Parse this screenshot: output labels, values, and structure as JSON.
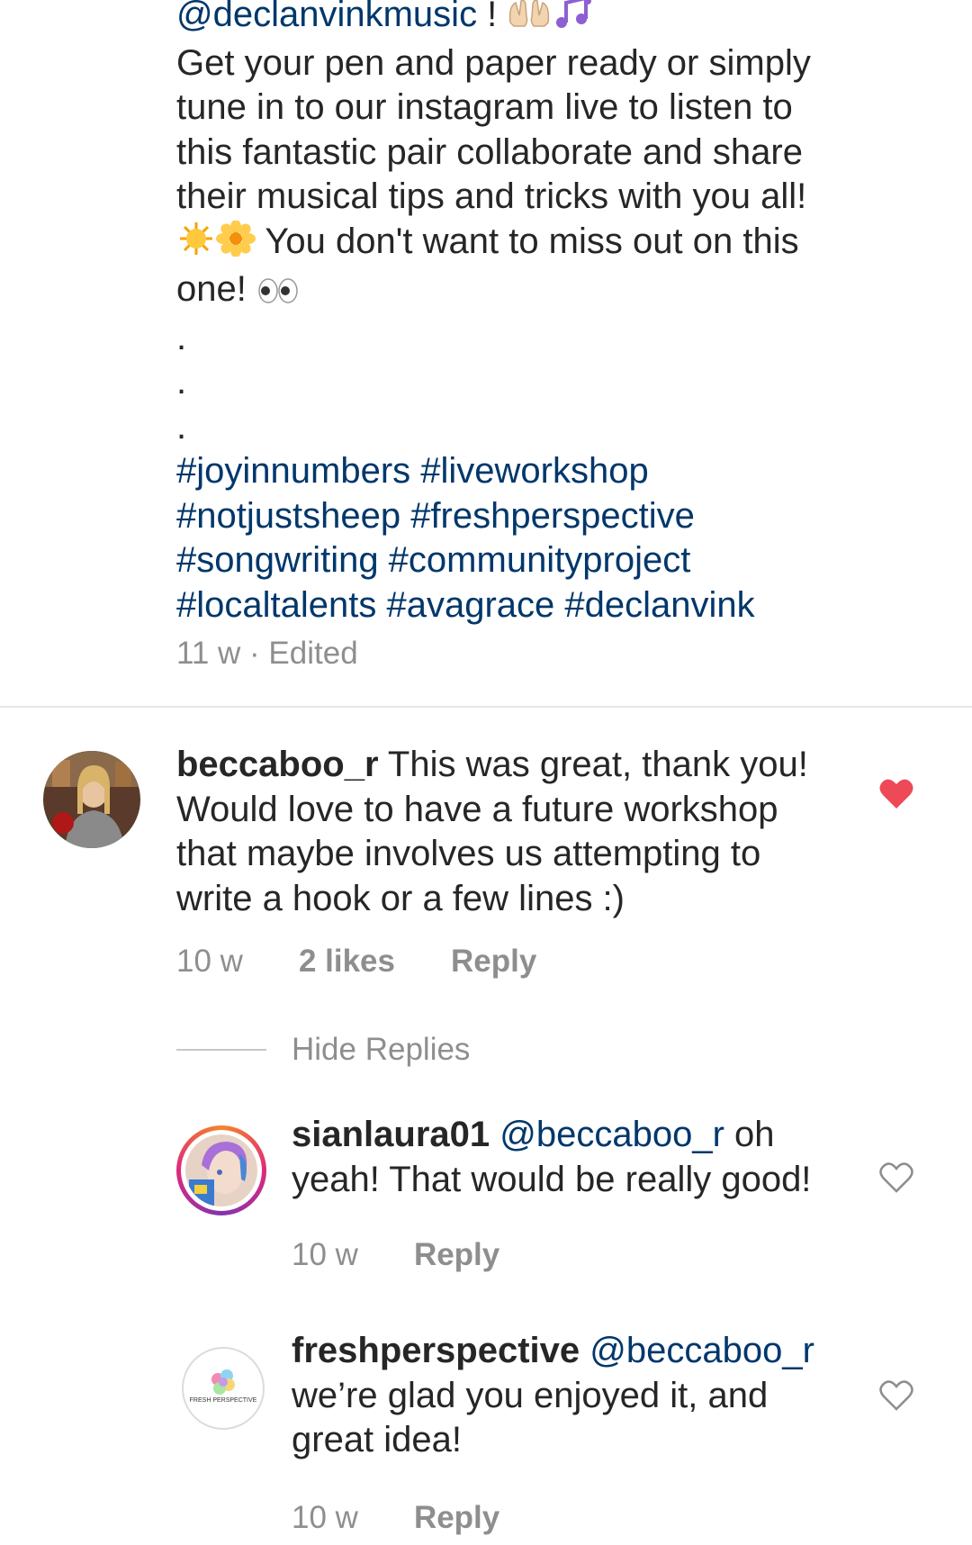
{
  "caption": {
    "mention": "@declanvinkmusic",
    "after_mention": " ! ",
    "line1": "Get your pen and paper ready or simply",
    "line2": "tune in to our instagram live to listen to",
    "line3": "this fantastic pair collaborate and share",
    "line4": "their musical tips and tricks with you all!",
    "line5": " You don't want to miss out on this",
    "line6": "one! ",
    "dots": ".",
    "hashtags_line1": "#joyinnumbers #liveworkshop",
    "hashtags_line2": "#notjustsheep #freshperspective",
    "hashtags_line3": "#songwriting #communityproject",
    "hashtags_line4": "#localtalents #avagrace #declanvink",
    "meta": "11 w · Edited"
  },
  "comments": [
    {
      "username": "beccaboo_r",
      "line1": " This was great, thank you!",
      "line2": "Would love to have a future workshop",
      "line3": "that maybe involves us attempting to",
      "line4": "write a hook or a few lines :)",
      "time": "10 w",
      "likes": "2 likes",
      "reply": "Reply",
      "liked": true
    }
  ],
  "hide_replies": "Hide Replies",
  "replies": [
    {
      "username": "sianlaura01",
      "mention": " @beccaboo_r",
      "line1_rest": " oh",
      "line2": "yeah! That would be really good!",
      "time": "10 w",
      "reply": "Reply",
      "liked": false
    },
    {
      "username": "freshperspective",
      "mention": " @beccaboo_r",
      "line2": "we’re glad you enjoyed it, and",
      "line3": "great idea!",
      "time": "10 w",
      "reply": "Reply",
      "liked": false
    }
  ],
  "logo_text": "FRESH PERSPECTIVE",
  "colors": {
    "text": "#262626",
    "secondary": "#8e8e8e",
    "link": "#00376b",
    "heart_liked": "#ed4956",
    "divider": "#e6e6e6"
  }
}
